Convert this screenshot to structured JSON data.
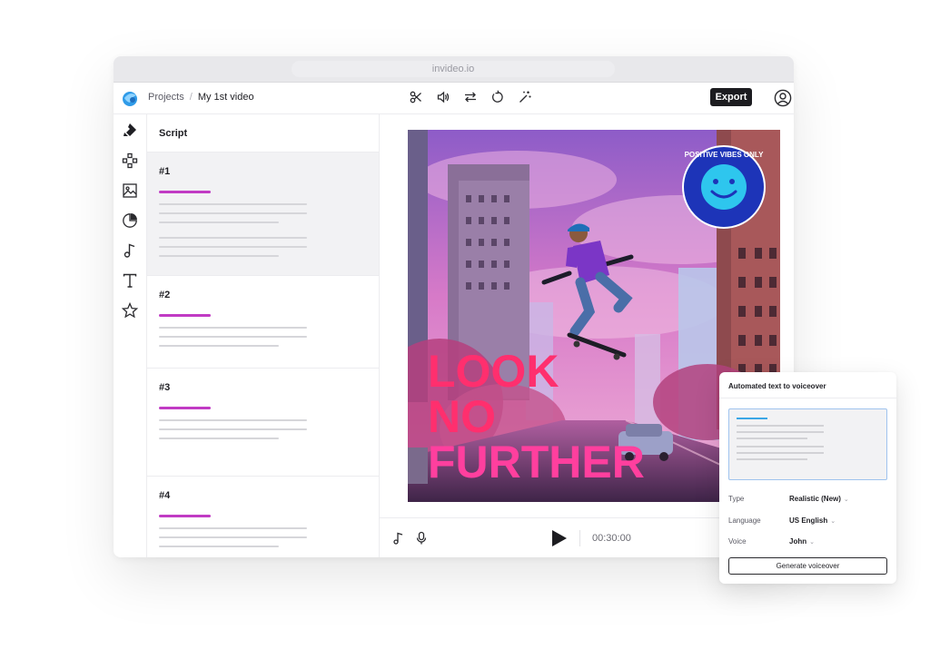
{
  "browser": {
    "url": "invideo.io"
  },
  "header": {
    "breadcrumb": {
      "root": "Projects",
      "separator": "/",
      "current": "My 1st video"
    },
    "tools": [
      "scissors-icon",
      "volume-icon",
      "swap-icon",
      "refresh-icon",
      "magic-wand-icon"
    ],
    "export_label": "Export"
  },
  "sidebar": {
    "items": [
      "brand-icon",
      "apps-icon",
      "media-icon",
      "sticker-icon",
      "music-icon",
      "text-icon",
      "star-icon"
    ]
  },
  "script": {
    "title": "Script",
    "scenes": [
      {
        "number": "#1",
        "active": true
      },
      {
        "number": "#2",
        "active": false
      },
      {
        "number": "#3",
        "active": false
      },
      {
        "number": "#4",
        "active": false
      }
    ]
  },
  "preview": {
    "headline": [
      "LOOK",
      "NO",
      "FURTHER"
    ],
    "sticker_text": "POSITIVE VIBES ONLY"
  },
  "playback": {
    "time": "00:30:00"
  },
  "voiceover": {
    "title": "Automated text to voiceover",
    "type_label": "Type",
    "type_value": "Realistic (New)",
    "language_label": "Language",
    "language_value": "US English",
    "voice_label": "Voice",
    "voice_value": "John",
    "generate_label": "Generate voiceover"
  },
  "colors": {
    "accent": "#c13bc4",
    "export_bg": "#1c1c20",
    "sticker": "#1d34b8",
    "headline": "#ff2f6e"
  }
}
